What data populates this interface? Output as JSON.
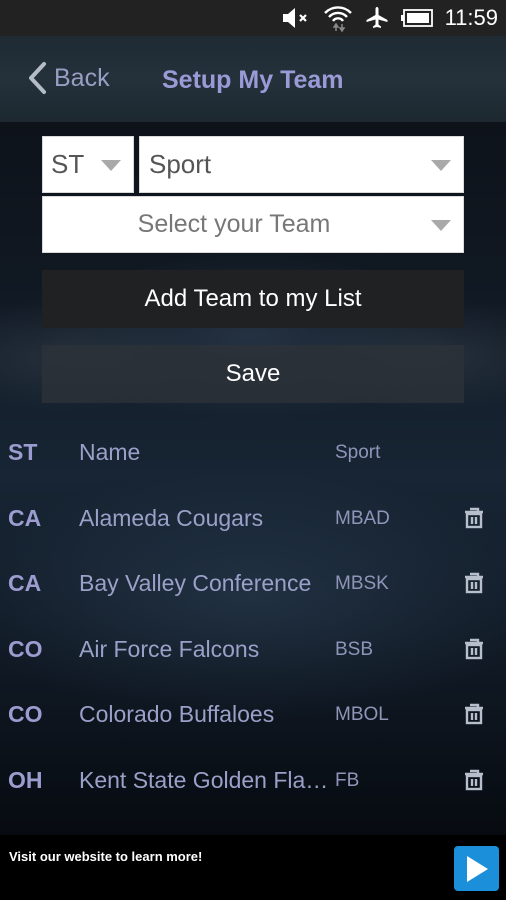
{
  "status_bar": {
    "icons": [
      "volume-muted-icon",
      "wifi-icon",
      "airplane-mode-icon",
      "battery-icon"
    ],
    "time": "11:59"
  },
  "header": {
    "back_label": "Back",
    "title": "Setup My Team"
  },
  "form": {
    "state_select": {
      "value": "ST"
    },
    "sport_select": {
      "value": "Sport"
    },
    "team_select": {
      "placeholder": "Select your Team"
    },
    "add_team_label": "Add Team to my List",
    "save_label": "Save"
  },
  "team_list": {
    "columns": {
      "state": "ST",
      "name": "Name",
      "sport": "Sport"
    },
    "rows": [
      {
        "state": "CA",
        "name": "Alameda Cougars",
        "sport": "MBAD"
      },
      {
        "state": "CA",
        "name": "Bay Valley Conference",
        "sport": "MBSK"
      },
      {
        "state": "CO",
        "name": "Air Force Falcons",
        "sport": "BSB"
      },
      {
        "state": "CO",
        "name": "Colorado Buffaloes",
        "sport": "MBOL"
      },
      {
        "state": "OH",
        "name": "Kent State Golden Fla…",
        "sport": "FB"
      }
    ]
  },
  "ad": {
    "text": "Visit our website to learn more!",
    "accent_color": "#1b8fda"
  },
  "colors": {
    "title": "#9a9ad6",
    "label": "#9ba0c8"
  }
}
